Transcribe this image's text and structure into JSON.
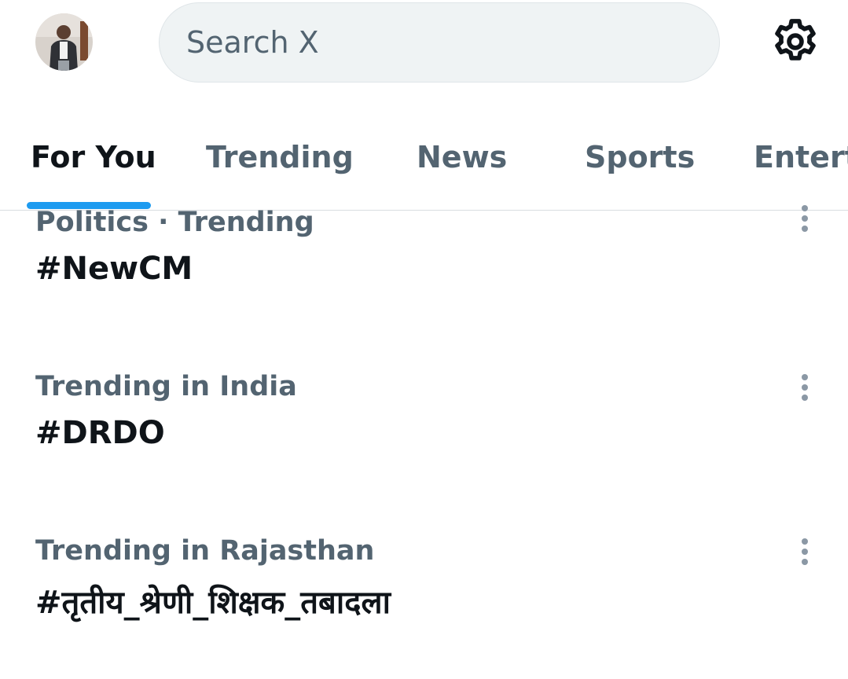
{
  "search": {
    "placeholder": "Search X"
  },
  "icons": {
    "avatar": "profile-avatar",
    "settings": "gear-icon",
    "more": "more-vertical-icon"
  },
  "tabs": [
    {
      "label": "For You",
      "active": true
    },
    {
      "label": "Trending",
      "active": false
    },
    {
      "label": "News",
      "active": false
    },
    {
      "label": "Sports",
      "active": false
    },
    {
      "label": "Entert",
      "active": false
    }
  ],
  "trends": [
    {
      "context": "Politics · Trending",
      "name": "#NewCM"
    },
    {
      "context": "Trending in India",
      "name": "#DRDO"
    },
    {
      "context": "Trending in Rajasthan",
      "name": "#तृतीय_श्रेणी_शिक्षक_तबादला"
    }
  ],
  "colors": {
    "accent": "#1d9bf0",
    "text_primary": "#0f1419",
    "text_secondary": "#536471",
    "search_bg": "#eff3f4"
  }
}
